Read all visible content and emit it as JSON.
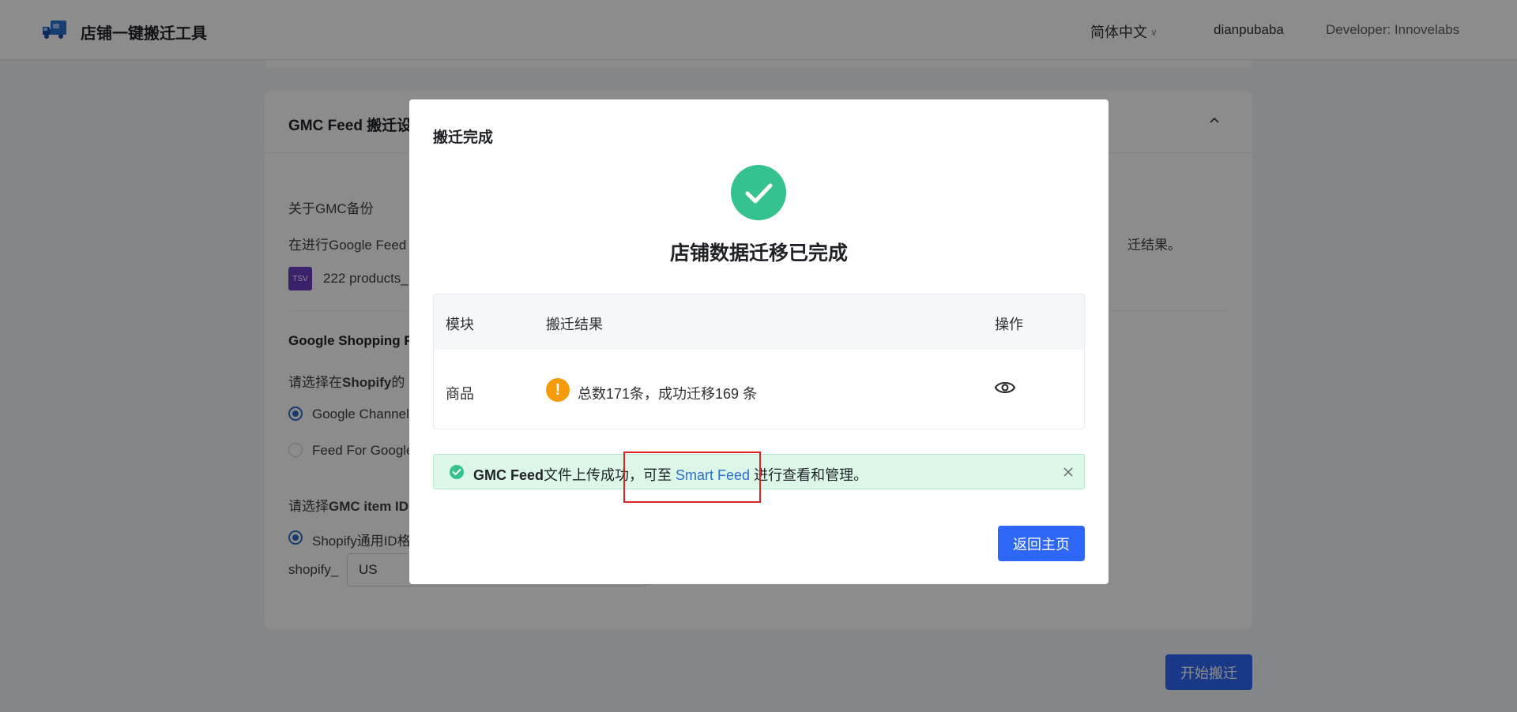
{
  "header": {
    "app_title": "店铺一键搬迁工具",
    "language": "简体中文",
    "user": "dianpubaba",
    "developer": "Developer: Innovelabs"
  },
  "background": {
    "card_title": "GMC Feed 搬迁设",
    "gmc_backup_title": "关于GMC备份",
    "gmc_backup_desc_left": "在进行Google Feed",
    "gmc_backup_desc_right": "迁结果。",
    "file_name": "222 products_",
    "file_badge": "TSV",
    "google_shopping_title": "Google Shopping F",
    "shopify_select_prefix": "请选择在",
    "shopify_select_bold": "Shopify",
    "shopify_select_suffix": "的",
    "radio_google_channel": "Google Channel",
    "radio_feed_for_google": "Feed For Google",
    "gmc_item_id_prefix": "请选择",
    "gmc_item_id_bold": "GMC item ID",
    "radio_shopify_id": "Shopify通用ID格",
    "shopify_prefix_label": "shopify_",
    "country_value": "US",
    "start_button": "开始搬迁"
  },
  "modal": {
    "title": "搬迁完成",
    "headline": "店铺数据迁移已完成",
    "table": {
      "headers": [
        "模块",
        "搬迁结果",
        "操作"
      ],
      "rows": [
        {
          "module": "商品",
          "result": "总数171条，成功迁移169 条"
        }
      ]
    },
    "alert": {
      "bold": "GMC Feed",
      "text_before_link": "文件上传成功，可至 ",
      "link": "Smart Feed",
      "text_after_link": " 进行查看和管理。"
    },
    "back_button": "返回主页"
  },
  "colors": {
    "primary": "#2e66f6",
    "success": "#34c38f",
    "warning": "#f59a0b",
    "link": "#2c6ecb",
    "highlight": "#e02424"
  }
}
